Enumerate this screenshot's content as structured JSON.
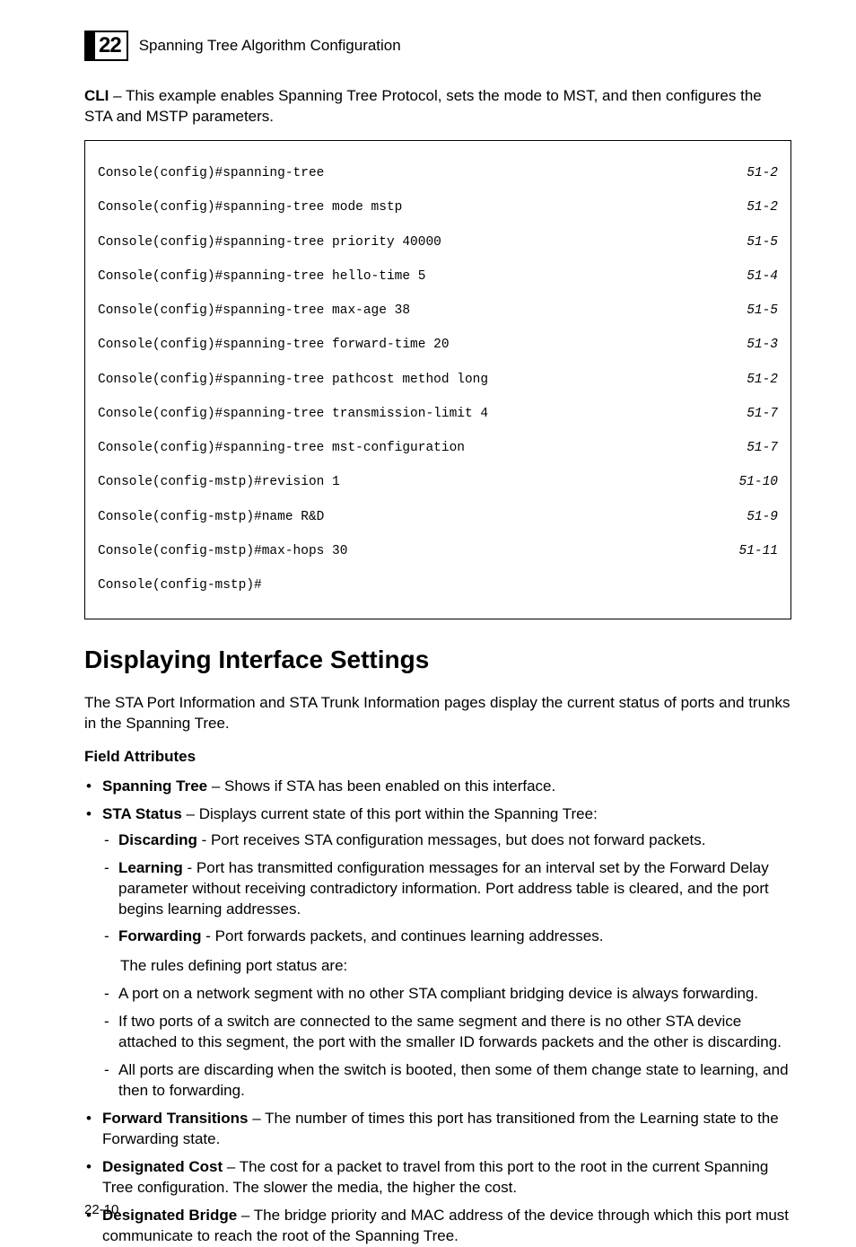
{
  "header": {
    "chapter_number": "22",
    "section_title": "Spanning Tree Algorithm Configuration"
  },
  "intro": {
    "cli_bold": "CLI",
    "cli_text": " – This example enables Spanning Tree Protocol, sets the mode to MST, and then configures the STA and MSTP parameters."
  },
  "console": [
    {
      "l": "Console(config)#spanning-tree",
      "r": "51-2"
    },
    {
      "l": "Console(config)#spanning-tree mode mstp",
      "r": "51-2"
    },
    {
      "l": "Console(config)#spanning-tree priority 40000",
      "r": "51-5"
    },
    {
      "l": "Console(config)#spanning-tree hello-time 5",
      "r": "51-4"
    },
    {
      "l": "Console(config)#spanning-tree max-age 38",
      "r": "51-5"
    },
    {
      "l": "Console(config)#spanning-tree forward-time 20",
      "r": "51-3"
    },
    {
      "l": "Console(config)#spanning-tree pathcost method long",
      "r": "51-2"
    },
    {
      "l": "Console(config)#spanning-tree transmission-limit 4",
      "r": "51-7"
    },
    {
      "l": "Console(config)#spanning-tree mst-configuration",
      "r": "51-7"
    },
    {
      "l": "Console(config-mstp)#revision 1",
      "r": "51-10"
    },
    {
      "l": "Console(config-mstp)#name R&D",
      "r": "51-9"
    },
    {
      "l": "Console(config-mstp)#max-hops 30",
      "r": "51-11"
    },
    {
      "l": "Console(config-mstp)#",
      "r": ""
    }
  ],
  "h1": "Displaying Interface Settings",
  "after_h1": "The STA Port Information and STA Trunk Information pages display the current status of ports and trunks in the Spanning Tree.",
  "field_attributes_label": "Field Attributes",
  "bullets": {
    "b1": {
      "bold": "Spanning Tree",
      "rest": " – Shows if STA has been enabled on this interface."
    },
    "b2": {
      "bold": "STA Status",
      "rest": " – Displays current state of this port within the Spanning Tree:",
      "subs": {
        "s1": {
          "bold": "Discarding",
          "rest": " - Port receives STA configuration messages, but does not forward packets."
        },
        "s2": {
          "bold": "Learning",
          "rest": " - Port has transmitted configuration messages for an interval set by the Forward Delay parameter without receiving contradictory information. Port address table is cleared, and the port begins learning addresses."
        },
        "s3": {
          "bold": "Forwarding",
          "rest": " - Port forwards packets, and continues learning addresses."
        }
      },
      "rules_intro": "The rules defining port status are:",
      "rules": {
        "r1": "A port on a network segment with no other STA compliant bridging device is always forwarding.",
        "r2": "If two ports of a switch are connected to the same segment and there is no other STA device attached to this segment, the port with the smaller ID forwards packets and the other is discarding.",
        "r3": "All ports are discarding when the switch is booted, then some of them change state to learning, and then to forwarding."
      }
    },
    "b3": {
      "bold": "Forward Transitions",
      "rest": " – The number of times this port has transitioned from the Learning state to the Forwarding state."
    },
    "b4": {
      "bold": "Designated Cost",
      "rest": " – The cost for a packet to travel from this port to the root in the current Spanning Tree configuration. The slower the media, the higher the cost."
    },
    "b5": {
      "bold": "Designated Bridge",
      "rest": " – The bridge priority and MAC address of the device through which this port must communicate to reach the root of the Spanning Tree."
    }
  },
  "page_number": "22-10"
}
